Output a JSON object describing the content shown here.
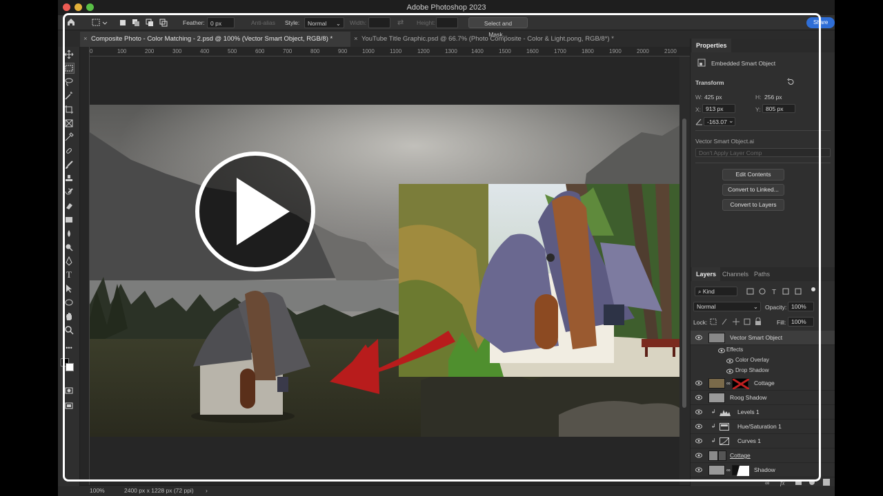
{
  "app": {
    "title": "Adobe Photoshop 2023"
  },
  "options": {
    "feather_label": "Feather:",
    "feather_value": "0 px",
    "antialias_label": "Anti-alias",
    "style_label": "Style:",
    "style_value": "Normal",
    "width_label": "Width:",
    "height_label": "Height:",
    "select_mask_label": "Select and Mask...",
    "share_label": "Share"
  },
  "tabs": [
    {
      "label": "Composite Photo - Color Matching - 2.psd @ 100% (Vector Smart Object, RGB/8) *"
    },
    {
      "label": "YouTube Title Graphic.psd @ 66.7% (Photo Composite - Color & Light.pong, RGB/8*) *"
    }
  ],
  "ruler": {
    "top": [
      "0",
      "100",
      "200",
      "300",
      "400",
      "500",
      "600",
      "700",
      "800",
      "900",
      "1000",
      "1100",
      "1200",
      "1300",
      "1400",
      "1500",
      "1600",
      "1700",
      "1800",
      "1900",
      "2000",
      "2100"
    ]
  },
  "status": {
    "zoom": "100%",
    "doc_size": "2400 px x 1228 px (72 ppi)"
  },
  "properties": {
    "tab": "Properties",
    "object_type": "Embedded Smart Object",
    "transform_title": "Transform",
    "w_label": "W:",
    "w_value": "425 px",
    "h_label": "H:",
    "h_value": "256 px",
    "x_label": "X:",
    "x_value": "913 px",
    "y_label": "Y:",
    "y_value": "805 px",
    "angle_value": "-163.07",
    "filename": "Vector Smart Object.ai",
    "layer_comp_placeholder": "Don't Apply Layer Comp",
    "buttons": {
      "edit": "Edit Contents",
      "linked": "Convert to Linked...",
      "layers": "Convert to Layers"
    }
  },
  "layers_panel": {
    "tabs": [
      "Layers",
      "Channels",
      "Paths"
    ],
    "filter_kind": "Kind",
    "blend_mode": "Normal",
    "opacity_label": "Opacity:",
    "opacity_value": "100%",
    "lock_label": "Lock:",
    "fill_label": "Fill:",
    "fill_value": "100%",
    "layers": [
      {
        "name": "Vector Smart Object"
      },
      {
        "name": "Effects"
      },
      {
        "name": "Color Overlay"
      },
      {
        "name": "Drop Shadow"
      },
      {
        "name": "Cottage"
      },
      {
        "name": "Roog Shadow"
      },
      {
        "name": "Levels 1"
      },
      {
        "name": "Hue/Saturation 1"
      },
      {
        "name": "Curves 1"
      },
      {
        "name": "Cottage"
      },
      {
        "name": "Shadow"
      }
    ]
  },
  "colors": {
    "arrow": "#b81c1c",
    "share": "#2f6ed6",
    "frame": "#ffffff"
  }
}
